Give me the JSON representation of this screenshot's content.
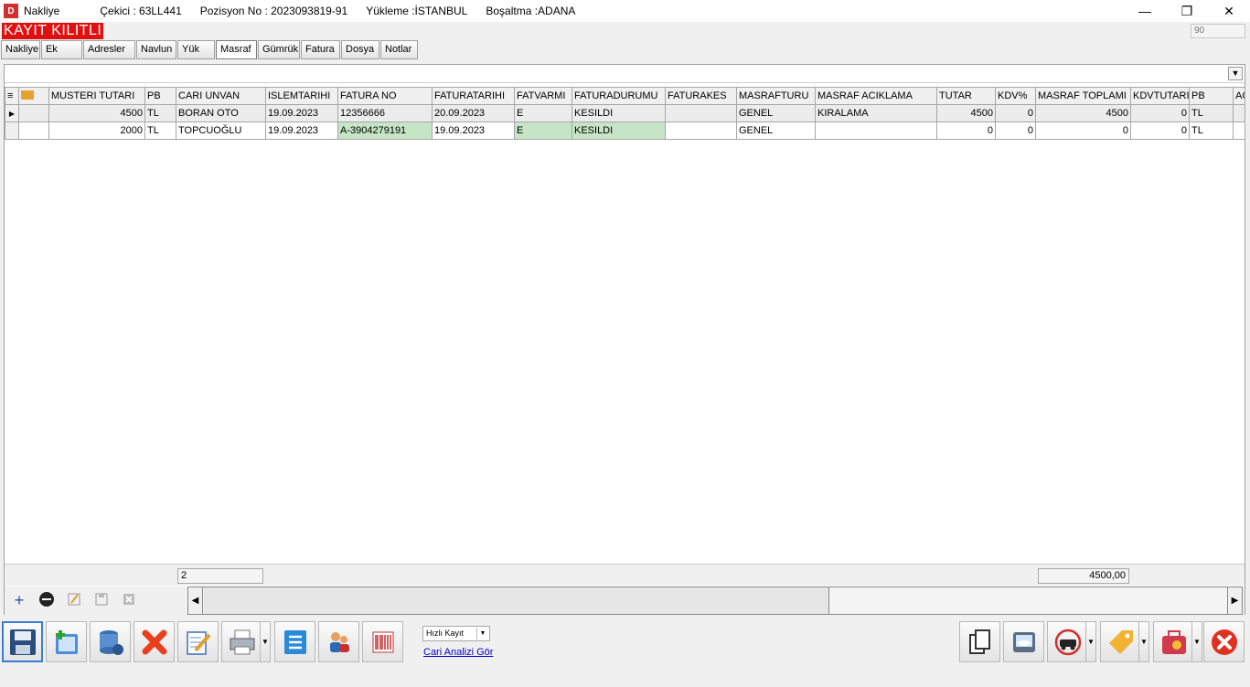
{
  "window": {
    "icon_text": "D",
    "app_title": "Nakliye",
    "cekici": "Çekici   : 63LL441",
    "pozisyon": "Pozisyon No : 2023093819-91",
    "yukleme": "Yükleme :İSTANBUL",
    "bosaltma": "Boşaltma :ADANA",
    "minimize": "—",
    "maximize": "❐",
    "close": "✕"
  },
  "locked_label": "KAYIT KILITLI",
  "corner_value": "90",
  "tabs": [
    "Nakliye",
    "Ek",
    "Adresler",
    "Navlun",
    "Yük",
    "Masraf",
    "Gümrük",
    "Fatura",
    "Dosya",
    "Notlar"
  ],
  "active_tab": "Masraf",
  "grid": {
    "columns": [
      "MUSTERI TUTARI",
      "PB",
      "CARI UNVAN",
      "ISLEMTARIHI",
      "FATURA NO",
      "FATURATARIHI",
      "FATVARMI",
      "FATURADURUMU",
      "FATURAKES",
      "MASRAFTURU",
      "MASRAF ACIKLAMA",
      "TUTAR",
      "KDV%",
      "MASRAF TOPLAMI",
      "KDVTUTARI",
      "PB",
      "AC"
    ],
    "rows": [
      [
        "4500",
        "TL",
        "BORAN OTO",
        "19.09.2023",
        "12356666",
        "20.09.2023",
        "E",
        "KESILDI",
        "",
        "GENEL",
        "KIRALAMA",
        "4500",
        "0",
        "4500",
        "0",
        "TL",
        ""
      ],
      [
        "2000",
        "TL",
        "TOPCUOĞLU",
        "19.09.2023",
        "A-3904279191",
        "19.09.2023",
        "E",
        "KESILDI",
        "",
        "GENEL",
        "",
        "0",
        "0",
        "0",
        "0",
        "TL",
        ""
      ]
    ]
  },
  "summary": {
    "count": "2",
    "total": "4500,00"
  },
  "quick_save": {
    "selected": "Hızlı Kayıt"
  },
  "cari_link": "Cari Analizi Gör"
}
